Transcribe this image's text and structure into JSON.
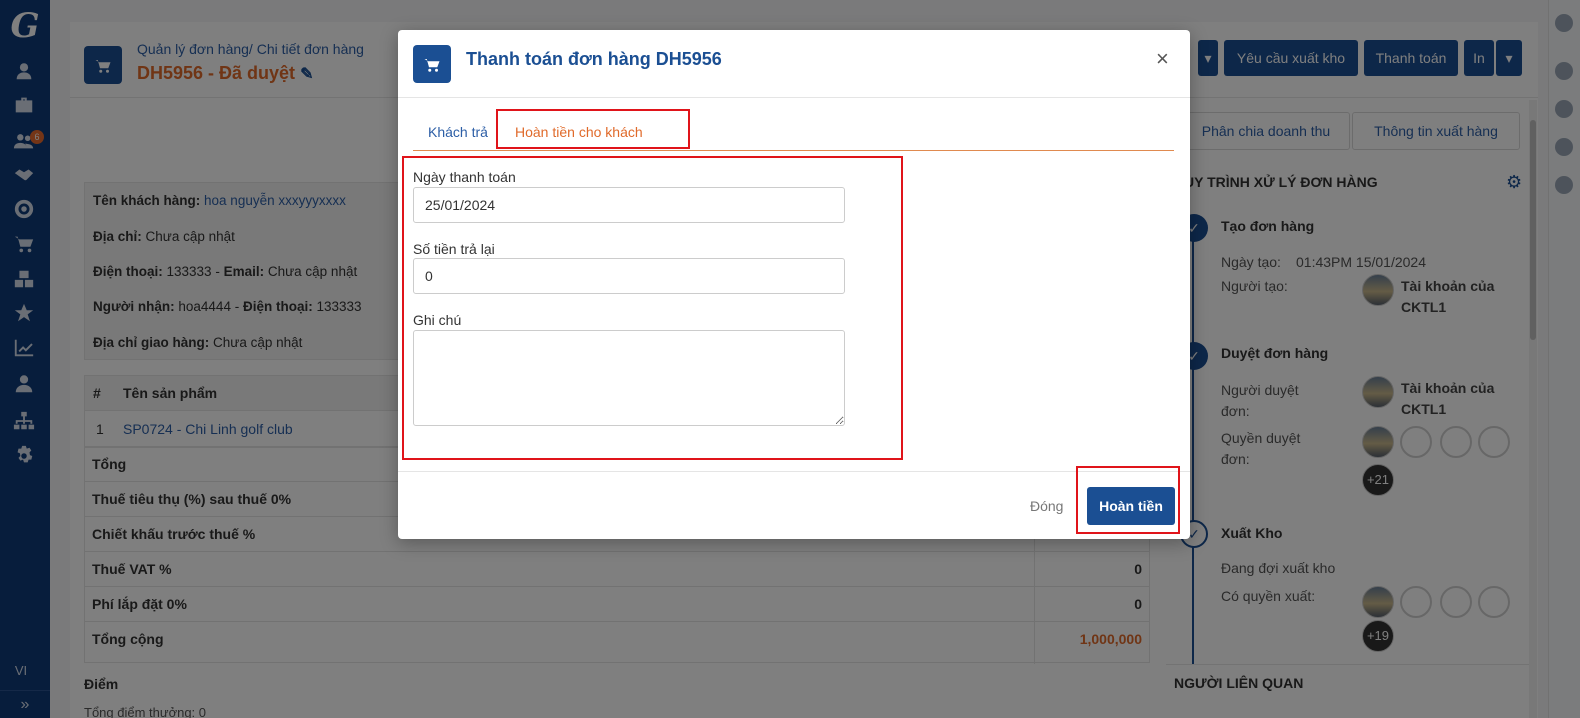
{
  "sidebar": {
    "logo": "G",
    "badge": "6",
    "language": "VI",
    "collapse": "»",
    "icons": [
      "user-icon",
      "briefcase-icon",
      "group-icon",
      "handshake-icon",
      "target-icon",
      "cart-icon",
      "boxes-icon",
      "star-icon",
      "chart-icon",
      "user-tie-icon",
      "sitemap-icon",
      "gear-icon"
    ]
  },
  "header": {
    "breadcrumb": "Quản lý đơn hàng/ Chi tiết đơn hàng",
    "order_title": "DH5956 - Đã duyệt",
    "buttons": {
      "export_request": "Yêu cầu xuất kho",
      "payment": "Thanh toán",
      "print": "In"
    }
  },
  "sub_tabs": {
    "revenue_split": "Phân chia doanh thu",
    "export_info": "Thông tin xuất hàng"
  },
  "customer": {
    "name_label": "Tên khách hàng:",
    "name_value": "hoa nguyễn xxxyyyxxxx",
    "address_label": "Địa chỉ:",
    "address_value": "Chưa cập nhật",
    "phone_label": "Điện thoại:",
    "phone_value": "133333",
    "email_label": "Email:",
    "email_value": "Chưa cập nhật",
    "receiver_label": "Người nhận:",
    "receiver_value": "hoa4444",
    "receiver_phone_label": "Điện thoại:",
    "receiver_phone_value": "133333",
    "shipping_label": "Địa chỉ giao hàng:",
    "shipping_value": "Chưa cập nhật"
  },
  "products": {
    "col_no": "#",
    "col_name": "Tên sản phẩm",
    "rows": [
      {
        "no": "1",
        "name": "SP0724 - Chi Linh golf club"
      }
    ]
  },
  "summary": {
    "total": "Tổng",
    "excise_tax": "Thuế tiêu thụ (%) sau thuế 0%",
    "discount": "Chiết khấu trước thuế %",
    "vat": "Thuế VAT %",
    "vat_value": "0",
    "install_fee": "Phí lắp đặt 0%",
    "install_fee_value": "0",
    "grand_total": "Tổng cộng",
    "grand_total_value": "1,000,000"
  },
  "points": {
    "label": "Điểm",
    "value": "Tổng điểm thưởng: 0"
  },
  "workflow": {
    "title": "UY TRÌNH XỬ LÝ ĐƠN HÀNG",
    "step1": "Tạo đơn hàng",
    "created_date_label": "Ngày tạo:",
    "created_date_value": "01:43PM 15/01/2024",
    "creator_label": "Người tạo:",
    "creator_value": "Tài khoản của CKTL1",
    "step2": "Duyệt đơn hàng",
    "approver_label": "Người duyệt đơn:",
    "approver_value": "Tài khoản của CKTL1",
    "approve_rights_label": "Quyền duyệt đơn:",
    "approve_rights_more": "+21",
    "step3": "Xuất Kho",
    "waiting": "Đang đợi xuất kho",
    "export_rights_label": "Có quyền xuất:",
    "export_rights_more": "+19"
  },
  "related": {
    "title": "NGƯỜI LIÊN QUAN"
  },
  "modal": {
    "title": "Thanh toán đơn hàng DH5956",
    "close": "×",
    "tab_customer_pays": "Khách trả",
    "tab_refund": "Hoàn tiền cho khách",
    "date_label": "Ngày thanh toán",
    "date_value": "25/01/2024",
    "amount_label": "Số tiền trả lại",
    "amount_value": "0",
    "note_label": "Ghi chú",
    "note_value": "",
    "btn_close": "Đóng",
    "btn_refund": "Hoàn tiền"
  }
}
